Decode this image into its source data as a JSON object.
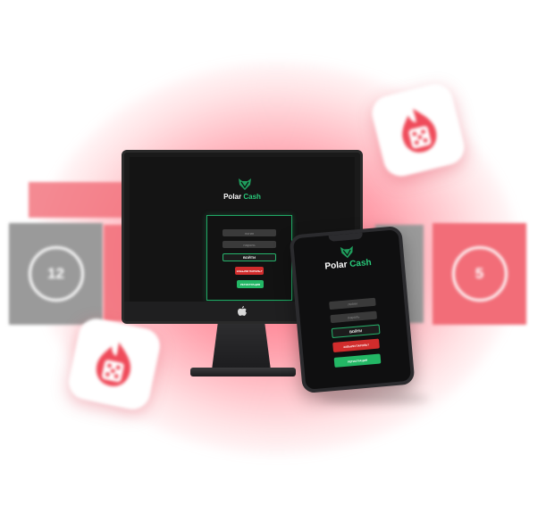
{
  "brand": {
    "name_main": "Polar",
    "name_accent": "Cash"
  },
  "tiles": {
    "left_number": "12",
    "right_number": "5"
  },
  "icons": {
    "logo": "polar-bear-logo-icon",
    "monitor_logo": "apple-logo-icon",
    "casino_card": "fire-dice-icon"
  },
  "colors": {
    "accent_green": "#29c97a",
    "button_red": "#d12c2c",
    "glow_pink": "#ff465f",
    "screen_bg": "#141414"
  },
  "desktop": {
    "login_placeholder": "логин",
    "password_placeholder": "пароль",
    "login_button": "ВОЙТИ",
    "forgot_button": "ЗАБЫЛИ ПАРОЛЬ?",
    "register_button": "РЕГИСТРАЦИЯ"
  },
  "mobile": {
    "login_placeholder": "логин",
    "password_placeholder": "пароль",
    "login_button": "ВОЙТИ",
    "forgot_button": "ЗАБЫЛИ ПАРОЛЬ?",
    "register_button": "РЕГИСТРАЦИЯ"
  }
}
